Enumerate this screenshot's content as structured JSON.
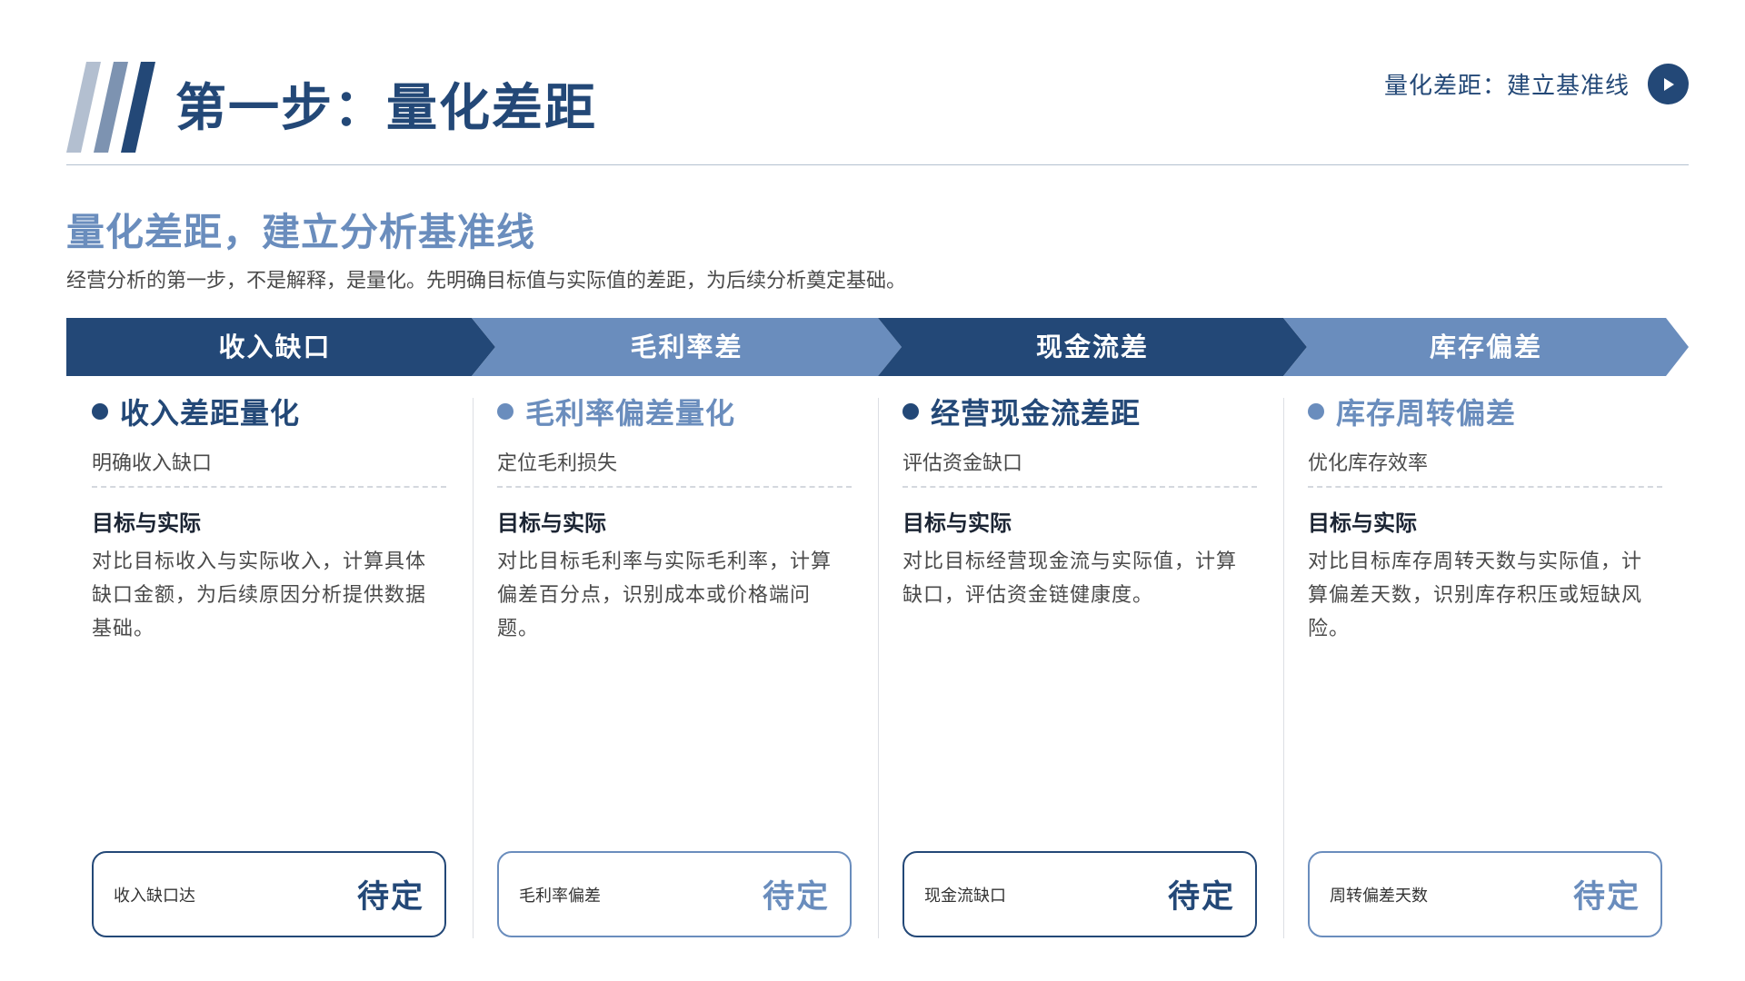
{
  "header": {
    "title": "第一步：量化差距",
    "nav_text": "量化差距：建立基准线",
    "nav_icon": "play-arrow-icon"
  },
  "section": {
    "title": "量化差距，建立分析基准线",
    "description": "经营分析的第一步，不是解释，是量化。先明确目标值与实际值的差距，为后续分析奠定基础。"
  },
  "colors": {
    "dark_blue": "#234877",
    "light_blue": "#6a8dbd",
    "rule": "#b4c0cf"
  },
  "tabs": [
    {
      "label": "收入缺口"
    },
    {
      "label": "毛利率差"
    },
    {
      "label": "现金流差"
    },
    {
      "label": "库存偏差"
    }
  ],
  "columns": [
    {
      "title": "收入差距量化",
      "subtitle": "明确收入缺口",
      "label": "目标与实际",
      "body": "对比目标收入与实际收入，计算具体缺口金额，为后续原因分析提供数据基础。",
      "metric_name": "收入缺口达",
      "metric_value": "待定"
    },
    {
      "title": "毛利率偏差量化",
      "subtitle": "定位毛利损失",
      "label": "目标与实际",
      "body": "对比目标毛利率与实际毛利率，计算偏差百分点，识别成本或价格端问题。",
      "metric_name": "毛利率偏差",
      "metric_value": "待定"
    },
    {
      "title": "经营现金流差距",
      "subtitle": "评估资金缺口",
      "label": "目标与实际",
      "body": "对比目标经营现金流与实际值，计算缺口，评估资金链健康度。",
      "metric_name": "现金流缺口",
      "metric_value": "待定"
    },
    {
      "title": "库存周转偏差",
      "subtitle": "优化库存效率",
      "label": "目标与实际",
      "body": "对比目标库存周转天数与实际值，计算偏差天数，识别库存积压或短缺风险。",
      "metric_name": "周转偏差天数",
      "metric_value": "待定"
    }
  ]
}
